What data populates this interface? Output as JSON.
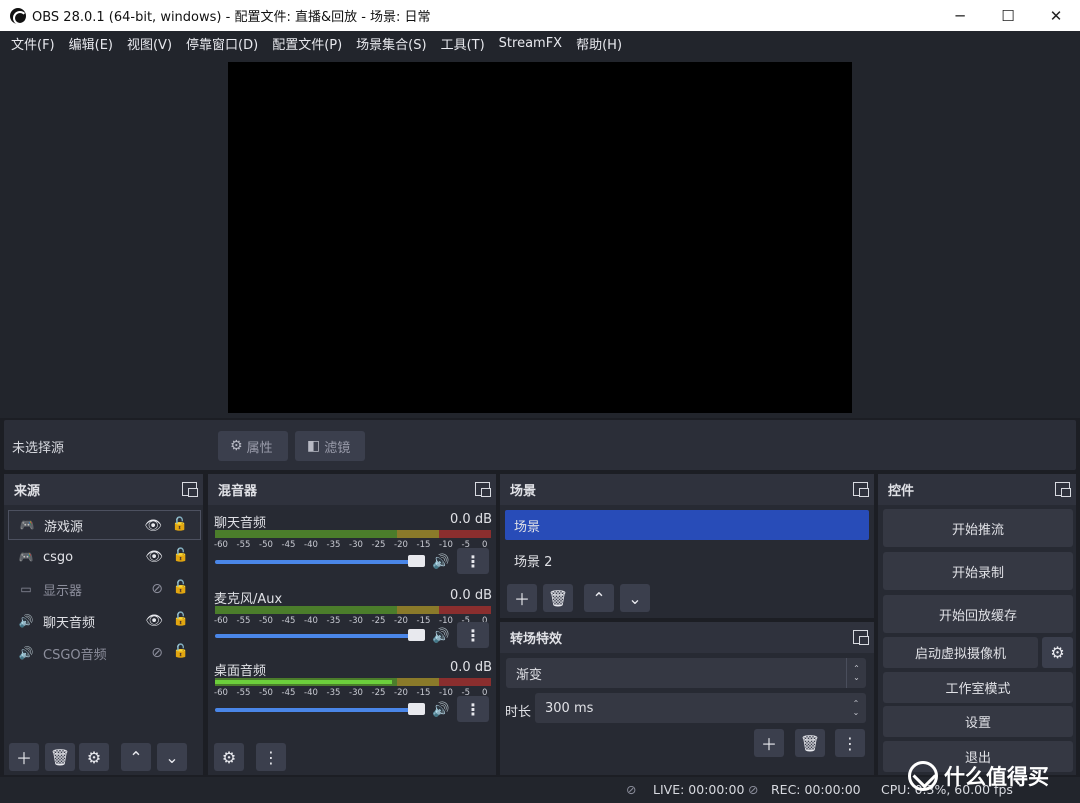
{
  "window": {
    "title": "OBS 28.0.1 (64-bit, windows) - 配置文件: 直播&回放 - 场景: 日常",
    "minimize": "─",
    "maximize": "☐",
    "close": "✕"
  },
  "menu": [
    "文件(F)",
    "编辑(E)",
    "视图(V)",
    "停靠窗口(D)",
    "配置文件(P)",
    "场景集合(S)",
    "工具(T)",
    "StreamFX",
    "帮助(H)"
  ],
  "source_toolbar": {
    "no_selection": "未选择源",
    "properties": "属性",
    "filters": "滤镜"
  },
  "sources": {
    "title": "来源",
    "items": [
      {
        "name": "游戏源",
        "icon": "gamepad-icon",
        "visible": true,
        "selected": true
      },
      {
        "name": "csgo",
        "icon": "gamepad-icon",
        "visible": true,
        "selected": false
      },
      {
        "name": "显示器",
        "icon": "monitor-icon",
        "visible": false,
        "selected": false
      },
      {
        "name": "聊天音频",
        "icon": "speaker-icon",
        "visible": true,
        "selected": false
      },
      {
        "name": "CSGO音频",
        "icon": "speaker-icon",
        "visible": false,
        "selected": false
      }
    ]
  },
  "mixer": {
    "title": "混音器",
    "ticks": [
      "-60",
      "-55",
      "-50",
      "-45",
      "-40",
      "-35",
      "-30",
      "-25",
      "-20",
      "-15",
      "-10",
      "-5",
      "0"
    ],
    "channels": [
      {
        "name": "聊天音频",
        "db": "0.0 dB",
        "level": 0
      },
      {
        "name": "麦克风/Aux",
        "db": "0.0 dB",
        "level": 0
      },
      {
        "name": "桌面音频",
        "db": "0.0 dB",
        "level": 0.64
      }
    ]
  },
  "scenes": {
    "title": "场景",
    "items": [
      {
        "name": "场景",
        "selected": true
      },
      {
        "name": "场景 2",
        "selected": false
      }
    ]
  },
  "transitions": {
    "title": "转场特效",
    "type": "渐变",
    "duration_label": "时长",
    "duration": "300 ms"
  },
  "controls": {
    "title": "控件",
    "start_stream": "开始推流",
    "start_record": "开始录制",
    "start_replay": "开始回放缓存",
    "virtual_cam": "启动虚拟摄像机",
    "studio_mode": "工作室模式",
    "settings": "设置",
    "exit": "退出"
  },
  "status": {
    "live": "LIVE: 00:00:00",
    "rec": "REC: 00:00:00",
    "cpu": "CPU: 0.3%, 60.00 fps"
  },
  "watermark": {
    "text": "什么值得买"
  },
  "colors": {
    "accent": "#284cb8",
    "fader": "#4a86e8",
    "meter_green": "#6ccf3c"
  }
}
